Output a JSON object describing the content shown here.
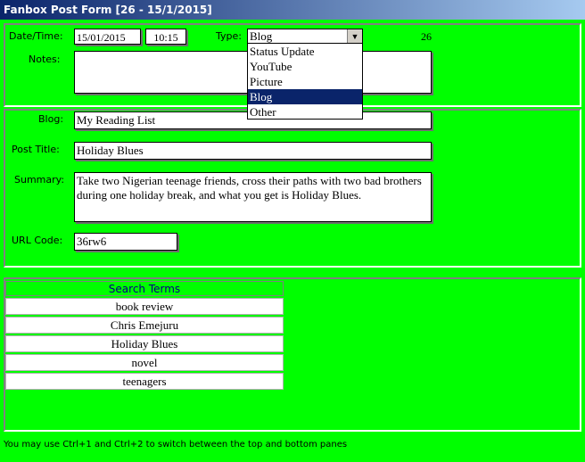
{
  "window": {
    "title": "Fanbox Post Form [26 - 15/1/2015]"
  },
  "top_pane": {
    "date_label": "Date/Time:",
    "date_value": "15/01/2015",
    "time_value": "10:15",
    "type_label": "Type:",
    "type_value": "Blog",
    "record_number": "26",
    "notes_label": "Notes:",
    "notes_value": "",
    "type_options": [
      "Status Update",
      "YouTube",
      "Picture",
      "Blog",
      "Other"
    ],
    "selected_option": "Blog"
  },
  "middle_pane": {
    "blog_label": "Blog:",
    "blog_value": "My Reading List",
    "post_title_label": "Post Title:",
    "post_title_value": "Holiday Blues",
    "summary_label": "Summary:",
    "summary_value": "Take two Nigerian teenage friends, cross their paths with two bad brothers during one holiday break, and what you get is Holiday Blues.",
    "url_code_label": "URL Code:",
    "url_code_value": "36rw6"
  },
  "bottom_pane": {
    "search_terms_header": "Search Terms",
    "search_terms": [
      "book review",
      "Chris Emejuru",
      "Holiday Blues",
      "novel",
      "teenagers"
    ]
  },
  "status_text": "You may use Ctrl+1 and Ctrl+2 to switch between the top and bottom panes",
  "colors": {
    "background": "#00ff00",
    "title_bar": "#0a246a",
    "selection": "#0a246a"
  }
}
